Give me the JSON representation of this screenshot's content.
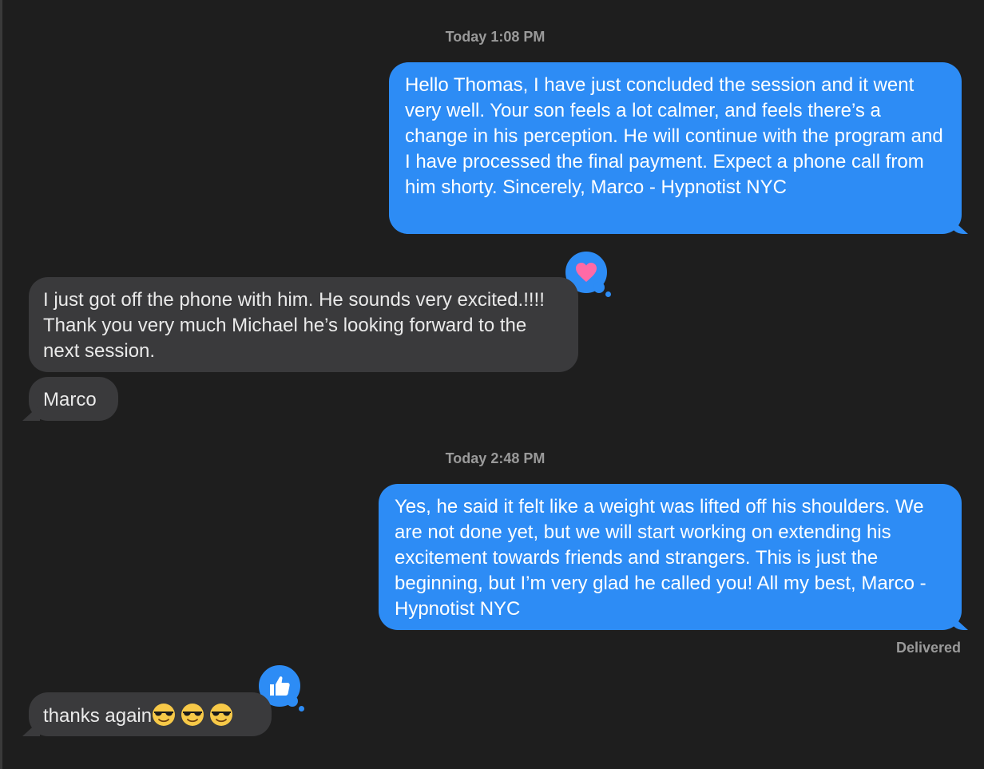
{
  "conversation": {
    "timestamp_1": "Today 1:08 PM",
    "timestamp_2": "Today 2:48 PM",
    "messages": [
      {
        "direction": "sent",
        "text": "Hello Thomas, I have just concluded the session and it went very well. Your son feels a lot calmer, and feels there’s a change in his perception. He will continue with the program and I have processed the final payment. Expect a phone call from him shorty. Sincerely, Marco - Hypnotist NYC"
      },
      {
        "direction": "received",
        "text": "I just got off the phone with him. He sounds very excited.!!!! Thank you very much Michael he’s looking forward to the next session.",
        "tapback": "heart-icon"
      },
      {
        "direction": "received",
        "text": "Marco"
      },
      {
        "direction": "sent",
        "text": "Yes, he said it felt like a weight was lifted off his shoulders. We are not done yet, but we will start working on extending his excitement towards friends and strangers. This is just the beginning, but I’m very glad he called you! All my best, Marco - Hypnotist NYC"
      },
      {
        "direction": "received",
        "text": "thanks again",
        "emoji": [
          "sunglasses-face-emoji",
          "sunglasses-face-emoji",
          "sunglasses-face-emoji"
        ],
        "tapback": "thumbs-up-icon"
      }
    ],
    "delivery_status": "Delivered"
  },
  "colors": {
    "background": "#1e1e1e",
    "sent_bubble": "#2d8cf5",
    "received_bubble": "#3a3a3c",
    "secondary_text": "#9a9a9a",
    "heart": "#ff6aa6"
  }
}
